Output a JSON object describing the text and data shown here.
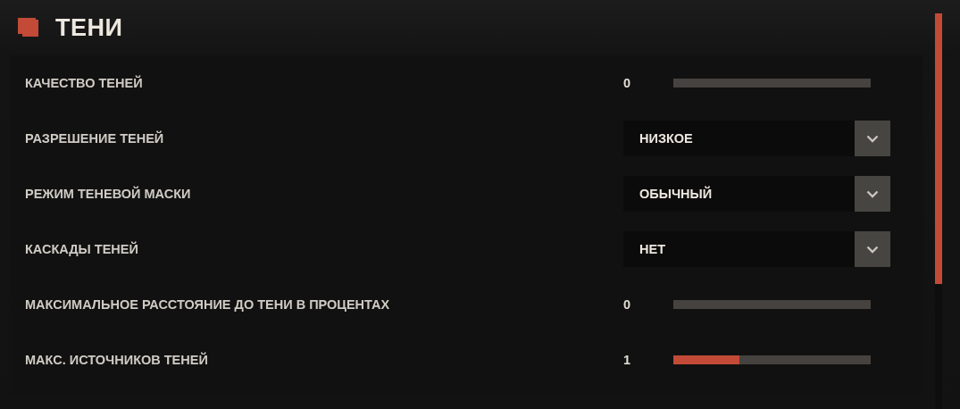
{
  "section": {
    "title": "ТЕНИ"
  },
  "settings": [
    {
      "kind": "slider",
      "label": "КАЧЕСТВО ТЕНЕЙ",
      "reading": "0",
      "level": 0
    },
    {
      "kind": "dropdown",
      "label": "РАЗРЕШЕНИЕ ТЕНЕЙ",
      "value": "НИЗКОЕ"
    },
    {
      "kind": "dropdown",
      "label": "РЕЖИМ ТЕНЕВОЙ МАСКИ",
      "value": "ОБЫЧНЫЙ"
    },
    {
      "kind": "dropdown",
      "label": "КАСКАДЫ ТЕНЕЙ",
      "value": "НЕТ"
    },
    {
      "kind": "slider",
      "label": "МАКСИМАЛЬНОЕ РАССТОЯНИЕ ДО ТЕНИ В ПРОЦЕНТАХ",
      "reading": "0",
      "level": 0
    },
    {
      "kind": "slider",
      "label": "МАКС. ИСТОЧНИКОВ ТЕНЕЙ",
      "reading": "1",
      "level": 0.335
    }
  ]
}
